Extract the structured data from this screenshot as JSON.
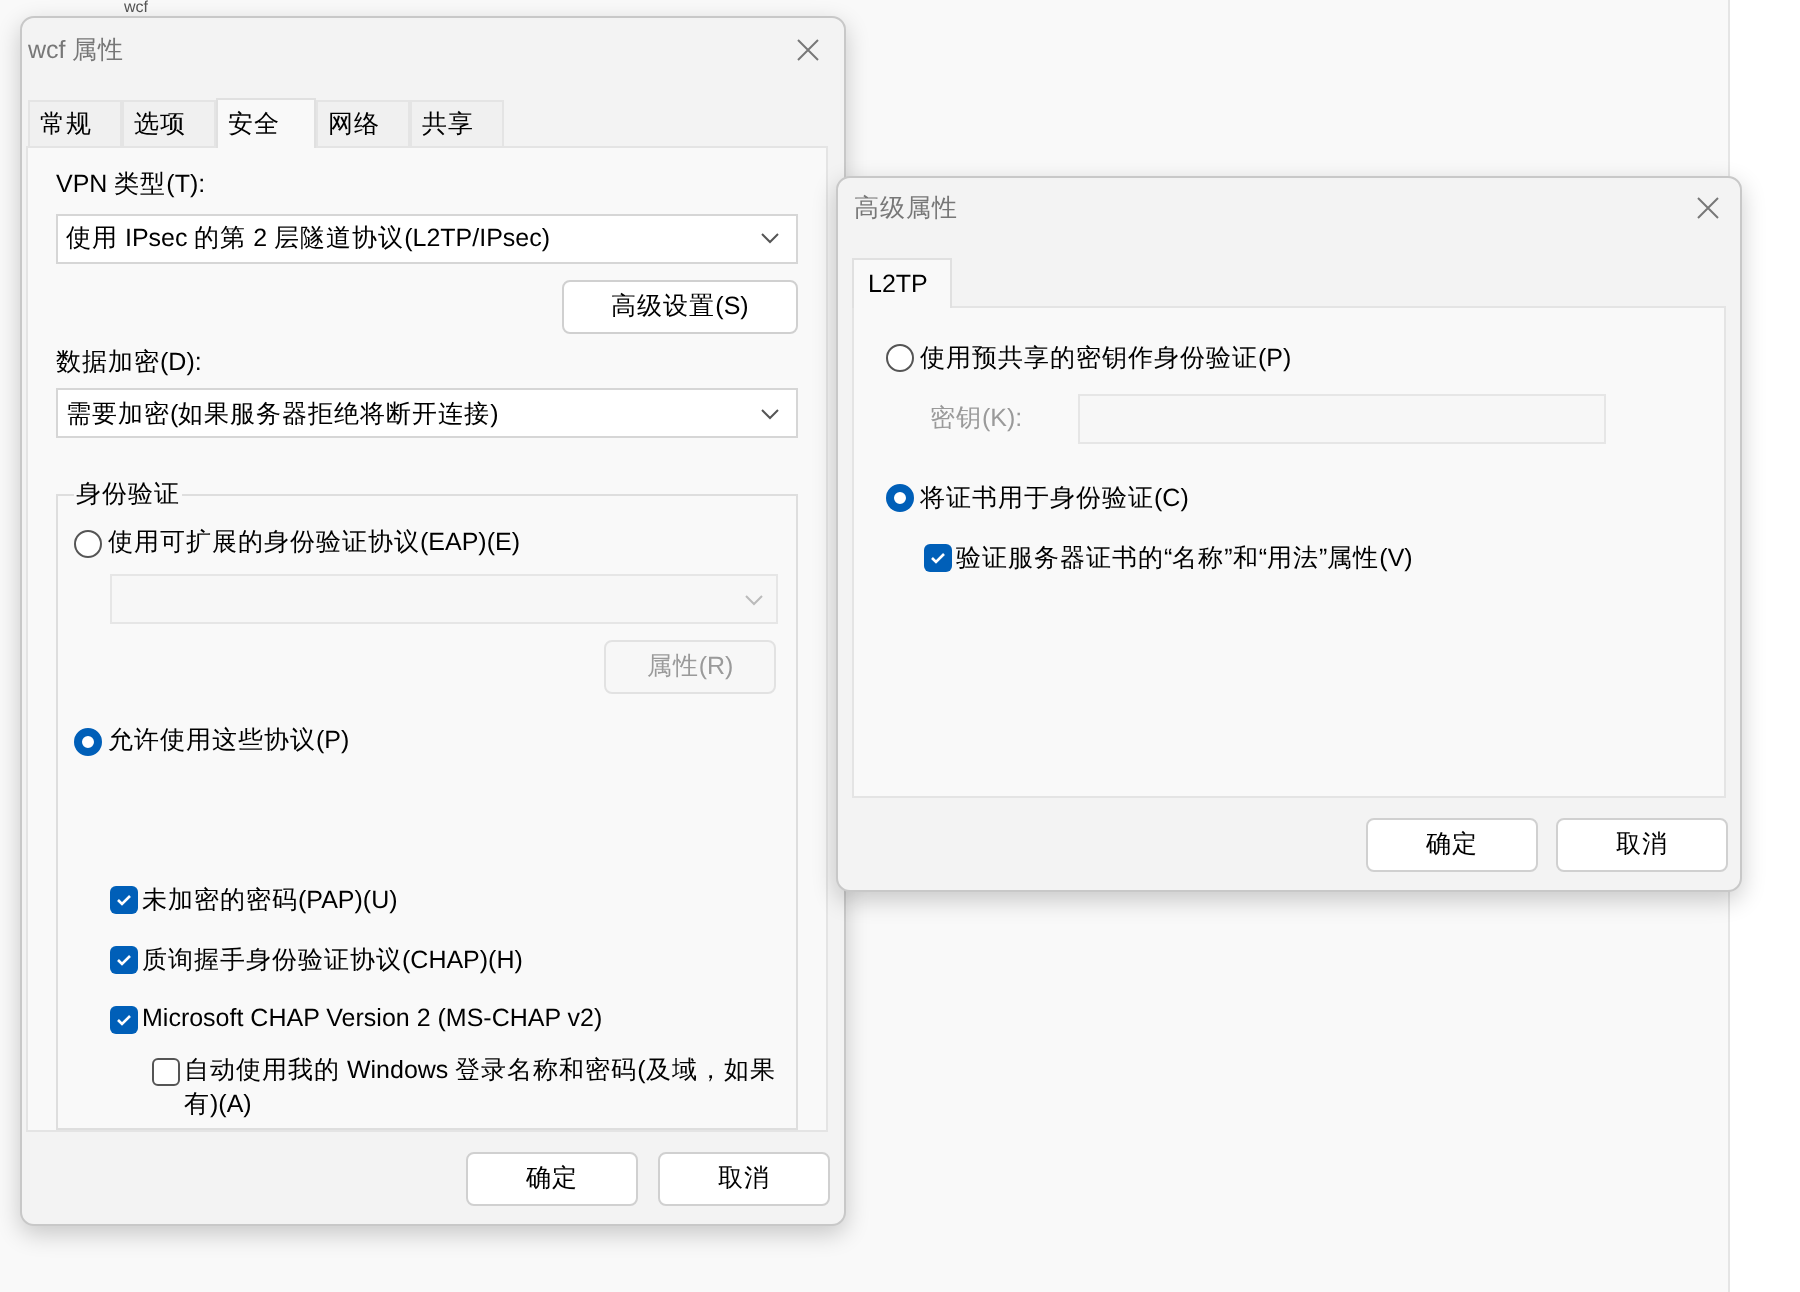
{
  "background": {
    "text": "wcf"
  },
  "main_dialog": {
    "title": "wcf 属性",
    "tabs": [
      {
        "label": "常规",
        "selected": false
      },
      {
        "label": "选项",
        "selected": false
      },
      {
        "label": "安全",
        "selected": true
      },
      {
        "label": "网络",
        "selected": false
      },
      {
        "label": "共享",
        "selected": false
      }
    ],
    "vpn_type": {
      "label": "VPN 类型(T):",
      "value": "使用 IPsec 的第 2 层隧道协议(L2TP/IPsec)"
    },
    "advanced_button": "高级设置(S)",
    "encryption": {
      "label": "数据加密(D):",
      "value": "需要加密(如果服务器拒绝将断开连接)"
    },
    "auth_group": {
      "title": "身份验证",
      "eap_option": {
        "label": "使用可扩展的身份验证协议(EAP)(E)",
        "selected": false
      },
      "eap_dropdown": {
        "disabled": true
      },
      "properties_button": {
        "label": "属性(R)",
        "disabled": true
      },
      "protocols_option": {
        "label": "允许使用这些协议(P)",
        "selected": true
      },
      "protocols": [
        {
          "label": "未加密的密码(PAP)(U)",
          "checked": true
        },
        {
          "label": "质询握手身份验证协议(CHAP)(H)",
          "checked": true
        },
        {
          "label": "Microsoft CHAP Version 2 (MS-CHAP v2)",
          "checked": true
        }
      ],
      "auto_logon": {
        "label": "自动使用我的 Windows 登录名称和密码(及域，如果有)(A)",
        "checked": false
      }
    },
    "buttons": [
      "确定",
      "取消"
    ]
  },
  "advanced_dialog": {
    "title": "高级属性",
    "tabs": [
      {
        "label": "L2TP",
        "selected": true
      }
    ],
    "psk_option": {
      "label": "使用预共享的密钥作身份验证(P)",
      "selected": false
    },
    "key_field": {
      "label": "密钥(K):",
      "disabled": true
    },
    "cert_option": {
      "label": "将证书用于身份验证(C)",
      "selected": true
    },
    "verify_checkbox": {
      "label": "验证服务器证书的“名称”和“用法”属性(V)",
      "checked": true
    },
    "buttons": [
      "确定",
      "取消"
    ]
  }
}
